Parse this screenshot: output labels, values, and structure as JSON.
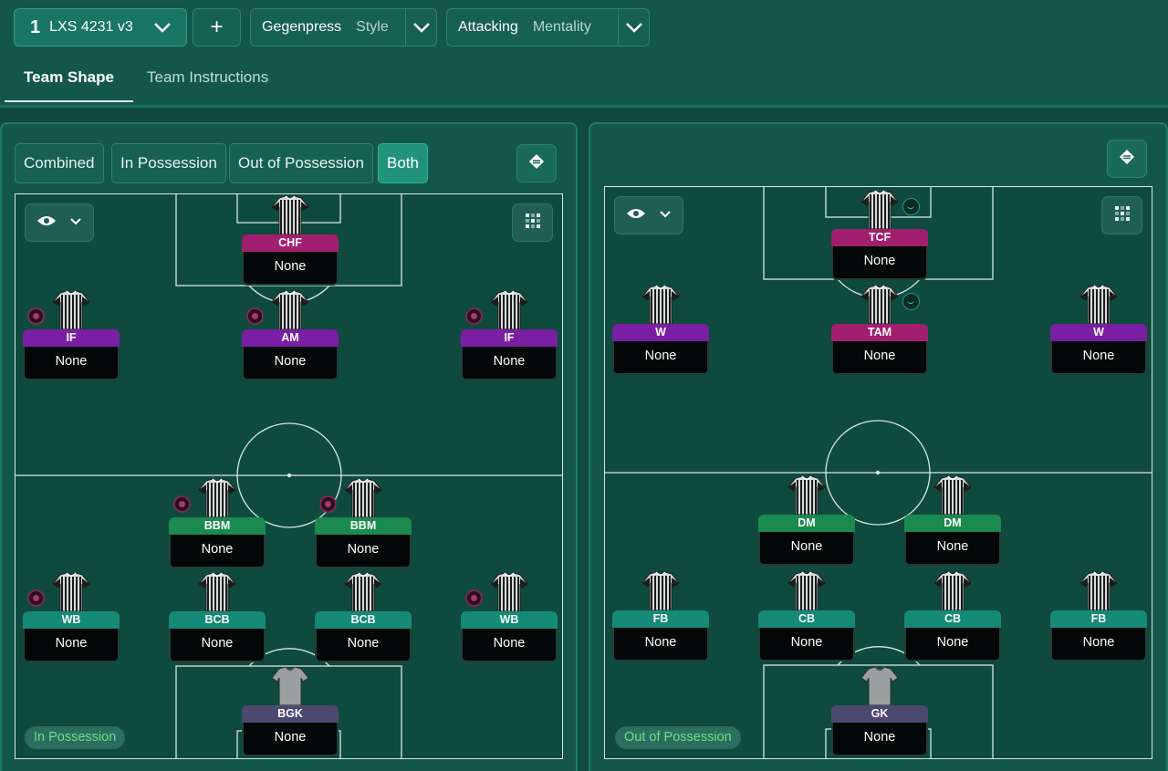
{
  "header": {
    "tactic_number": "1",
    "tactic_name": "LXS 4231 v3",
    "add_label": "+",
    "style_value": "Gegenpress",
    "style_label": "Style",
    "mentality_value": "Attacking",
    "mentality_label": "Mentality"
  },
  "tabs": [
    {
      "label": "Team Shape",
      "active": true
    },
    {
      "label": "Team Instructions",
      "active": false
    }
  ],
  "view_modes": [
    {
      "label": "Combined",
      "active": false
    },
    {
      "label": "In Possession",
      "active": false
    },
    {
      "label": "Out of Possession",
      "active": false
    },
    {
      "label": "Both",
      "active": true
    }
  ],
  "colors": {
    "attacker_role": "#a21e6f",
    "attacking_mid_role": "#7a1fa3",
    "midfield_role": "#1a8a4e",
    "defender_role": "#158a76",
    "goalkeeper_role": "#4c4970",
    "phase_badge_text": "#6fe07f"
  },
  "in_possession": {
    "phase_label": "In Possession",
    "players": [
      {
        "role": "CHF",
        "duty": "None",
        "kind": "att"
      },
      {
        "role": "IF",
        "duty": "None",
        "kind": "amc"
      },
      {
        "role": "AM",
        "duty": "None",
        "kind": "amc"
      },
      {
        "role": "IF",
        "duty": "None",
        "kind": "amc"
      },
      {
        "role": "BBM",
        "duty": "None",
        "kind": "mid"
      },
      {
        "role": "BBM",
        "duty": "None",
        "kind": "mid"
      },
      {
        "role": "WB",
        "duty": "None",
        "kind": "def"
      },
      {
        "role": "BCB",
        "duty": "None",
        "kind": "def"
      },
      {
        "role": "BCB",
        "duty": "None",
        "kind": "def"
      },
      {
        "role": "WB",
        "duty": "None",
        "kind": "def"
      },
      {
        "role": "BGK",
        "duty": "None",
        "kind": "gk"
      }
    ]
  },
  "out_of_possession": {
    "phase_label": "Out of Possession",
    "players": [
      {
        "role": "TCF",
        "duty": "None",
        "kind": "att"
      },
      {
        "role": "W",
        "duty": "None",
        "kind": "amc"
      },
      {
        "role": "TAM",
        "duty": "None",
        "kind": "att"
      },
      {
        "role": "W",
        "duty": "None",
        "kind": "amc"
      },
      {
        "role": "DM",
        "duty": "None",
        "kind": "mid"
      },
      {
        "role": "DM",
        "duty": "None",
        "kind": "mid"
      },
      {
        "role": "FB",
        "duty": "None",
        "kind": "def"
      },
      {
        "role": "CB",
        "duty": "None",
        "kind": "def"
      },
      {
        "role": "CB",
        "duty": "None",
        "kind": "def"
      },
      {
        "role": "FB",
        "duty": "None",
        "kind": "def"
      },
      {
        "role": "GK",
        "duty": "None",
        "kind": "gk"
      }
    ]
  }
}
